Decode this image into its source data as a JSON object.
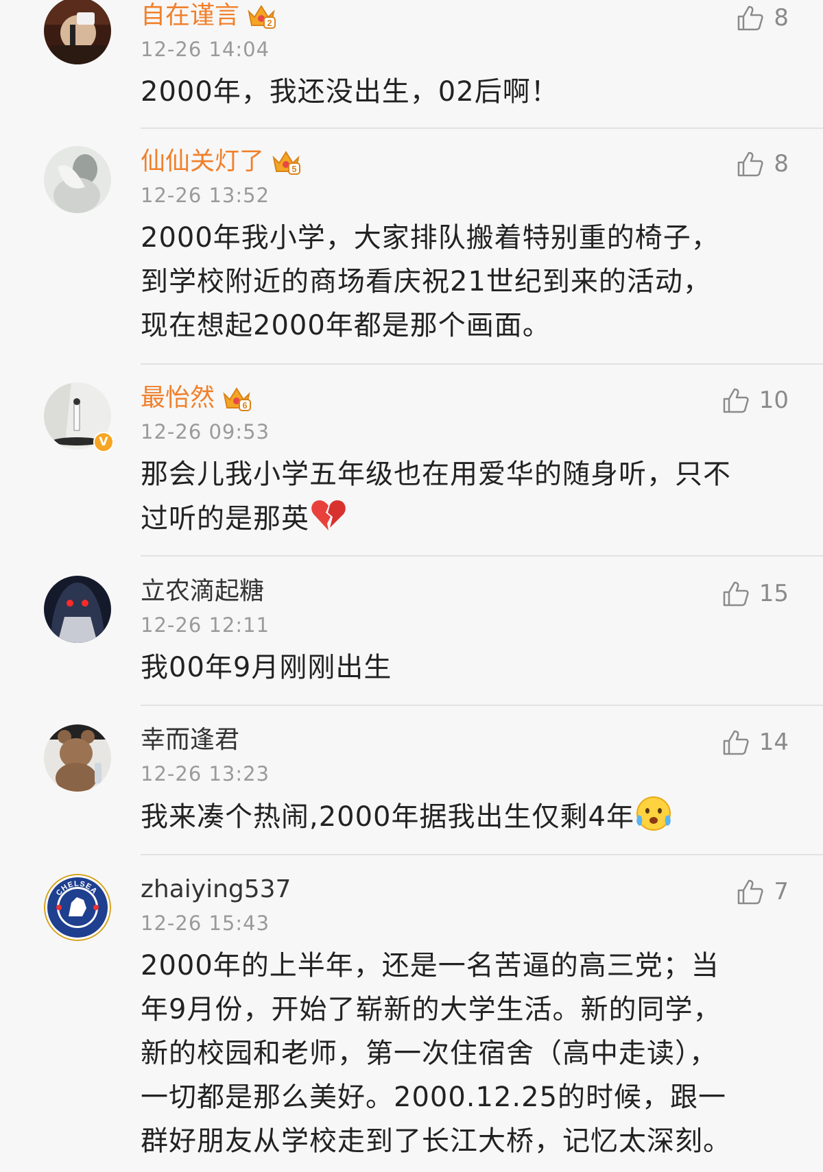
{
  "comments": [
    {
      "username": "自在谨言",
      "vip": true,
      "crown_level": "2",
      "time": "12-26 14:04",
      "text": "2000年，我还没出生，02后啊！",
      "likes": "8",
      "avatar": "microphone-photo"
    },
    {
      "username": "仙仙关灯了",
      "vip": true,
      "crown_level": "5",
      "time": "12-26 13:52",
      "text": "2000年我小学，大家排队搬着特别重的椅子，\n到学校附近的商场看庆祝21世纪到来的活动，\n现在想起2000年都是那个画面。",
      "likes": "8",
      "avatar": "white-portrait-photo"
    },
    {
      "username": "最怡然",
      "vip": true,
      "crown_level": "6",
      "time": "12-26 09:53",
      "text": "那会儿我小学五年级也在用爱华的随身听，只不\n过听的是那英",
      "likes": "10",
      "avatar": "white-room-photo",
      "verified": true,
      "verified_mark": "V",
      "emoji": "broken-heart"
    },
    {
      "username": "立农滴起糖",
      "vip": false,
      "time": "12-26 12:11",
      "text": "我00年9月刚刚出生",
      "likes": "15",
      "avatar": "dark-anime-photo"
    },
    {
      "username": "幸而逢君",
      "vip": false,
      "time": "12-26 13:23",
      "text": "我来凑个热闹,2000年据我出生仅剩4年",
      "likes": "14",
      "avatar": "teddy-bear-photo",
      "emoji": "crying-laughing-face"
    },
    {
      "username": "zhaiying537",
      "vip": false,
      "time": "12-26 15:43",
      "text": "2000年的上半年，还是一名苦逼的高三党；当\n年9月份，开始了崭新的大学生活。新的同学，\n新的校园和老师，第一次住宿舍（高中走读），\n一切都是那么美好。2000.12.25的时候，跟一\n群好朋友从学校走到了长江大桥，记忆太深刻。",
      "likes": "7",
      "avatar": "chelsea-badge",
      "avatar_text": "CHELSEA"
    }
  ],
  "colors": {
    "background": "#f7f7f7",
    "vip_name": "#f0802c",
    "meta_gray": "#9a9a9a",
    "crown_gold": "#f4a623",
    "divider": "#e2e2e2"
  }
}
